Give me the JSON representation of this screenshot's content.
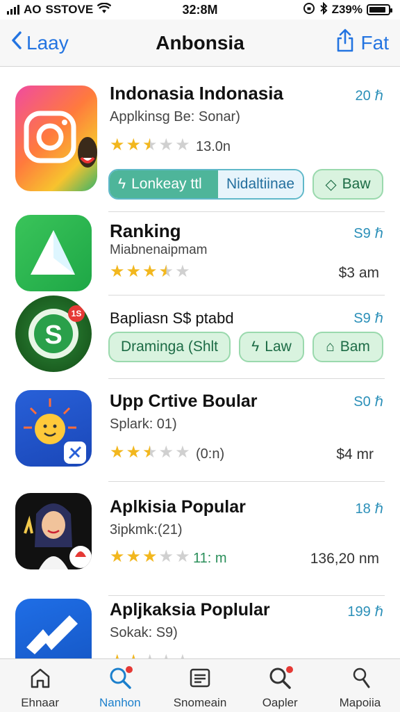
{
  "status": {
    "carrier": "SSTOVE",
    "carrier_prefix": "AO",
    "time": "32:8M",
    "battery": "Z39%"
  },
  "nav": {
    "back_label": "Laay",
    "title": "Anbonsia",
    "action_label": "Fat"
  },
  "apps": [
    {
      "name": "Indonasia Indonasia",
      "subtitle": "Applkinsg Be: Sonar)",
      "rank": "20 ℏ",
      "rating": 2.5,
      "meta": "13.0n",
      "buttons": {
        "split_a": "Lonkeay ttl",
        "split_b": "Nidaltiinae",
        "right": "Baw"
      }
    },
    {
      "name": "Ranking",
      "subtitle": "Miabnenaipmam",
      "rank": "S9 ℏ",
      "rating": 3.5,
      "price": "$3 am"
    },
    {
      "name": "Bapliasn S$ ptabd",
      "rank": "S9 ℏ",
      "icon_badge": "1S",
      "buttons": {
        "left": "Draminga (Shlt",
        "mid": "Law",
        "right": "Bam"
      }
    },
    {
      "name": "Upp Crtive Boular",
      "subtitle": "Splark: 01)",
      "rank": "S0 ℏ",
      "rating": 2.5,
      "meta": "(0:n)",
      "price": "$4 mr"
    },
    {
      "name": "Aplkisia Popular",
      "subtitle": "3ipkmk:(21)",
      "rank": "18 ℏ",
      "rating": 3,
      "meta": "11: m",
      "price": "136,20 nm"
    },
    {
      "name": "Apljkaksia Poplular",
      "subtitle": "Sokak: S9)",
      "rank": "199 ℏ"
    }
  ],
  "tabs": [
    {
      "label": "Ehnaar",
      "icon": "home-icon"
    },
    {
      "label": "Nanhon",
      "icon": "search-icon",
      "active": true
    },
    {
      "label": "Snomeain",
      "icon": "grid-icon"
    },
    {
      "label": "Oapler",
      "icon": "search-icon"
    },
    {
      "label": "Mapoiia",
      "icon": "person-icon"
    }
  ],
  "colors": {
    "accent": "#2374e1",
    "rank": "#2a8fb8",
    "star": "#f2b71e",
    "button_green": "#d9f3df",
    "active_tab": "#1b7fcc"
  }
}
